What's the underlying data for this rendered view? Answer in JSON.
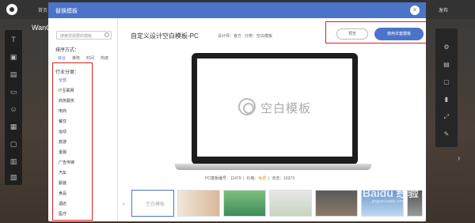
{
  "editor": {
    "home": "首页",
    "publish": "发布",
    "brand": "WanC"
  },
  "modal": {
    "title": "替换模板",
    "close": "×"
  },
  "sidebar": {
    "search_placeholder": "搜索您需要的模板",
    "sort_title": "排序方式：",
    "sort_options": [
      "综合",
      "推荐",
      "时间",
      "热度"
    ],
    "category_title": "行业分类：",
    "categories": [
      "全部",
      "IT互联网",
      "商务服务",
      "电商",
      "餐饮",
      "运动",
      "旅游",
      "金融",
      "广告传媒",
      "汽车",
      "服装",
      "食品",
      "酒店",
      "医疗"
    ]
  },
  "template": {
    "title": "自定义设计空白模板-PC",
    "designer": "设计师：官方",
    "category": "分类：空白模板",
    "preview_label": "预览",
    "use_label": "使用本套模板",
    "screen_text": "空白模板",
    "info_code": "PC模板编号：11479",
    "info_price_label": "价格：",
    "info_price_value": "免费",
    "info_views": "浏览：16373"
  },
  "thumbnails": {
    "first_label": "空白模板",
    "prev": "‹",
    "next": "›"
  },
  "watermark": {
    "text": "Baidu 经验",
    "sub": "jingyan.baidu.com"
  },
  "colors": {
    "accent": "#4b74c9",
    "highlight": "#e02020",
    "price": "#e6a100"
  }
}
